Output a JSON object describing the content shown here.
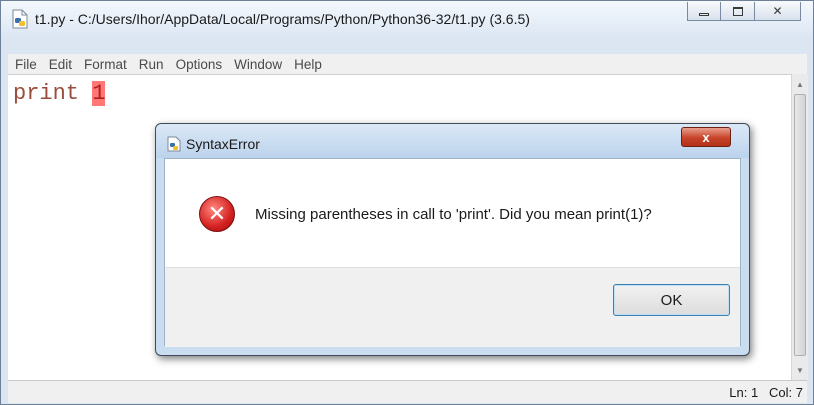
{
  "window": {
    "title": "t1.py - C:/Users/Ihor/AppData/Local/Programs/Python/Python36-32/t1.py (3.6.5)"
  },
  "menu": [
    "File",
    "Edit",
    "Format",
    "Run",
    "Options",
    "Window",
    "Help"
  ],
  "editor": {
    "keyword": "print",
    "space": " ",
    "highlighted_token": "1"
  },
  "status": {
    "text": "Ln: 1   Col: 7"
  },
  "dialog": {
    "title": "SyntaxError",
    "close_label": "x",
    "message": "Missing parentheses in call to 'print'. Did you mean print(1)?",
    "ok_label": "OK"
  },
  "colors": {
    "error_highlight": "#ff7777",
    "keyword": "#9a4d3c",
    "dialog_frame": "#c9dcf0"
  },
  "icons": {
    "app": "idle-python-file-icon",
    "error": "error-icon",
    "close": "close-icon"
  }
}
